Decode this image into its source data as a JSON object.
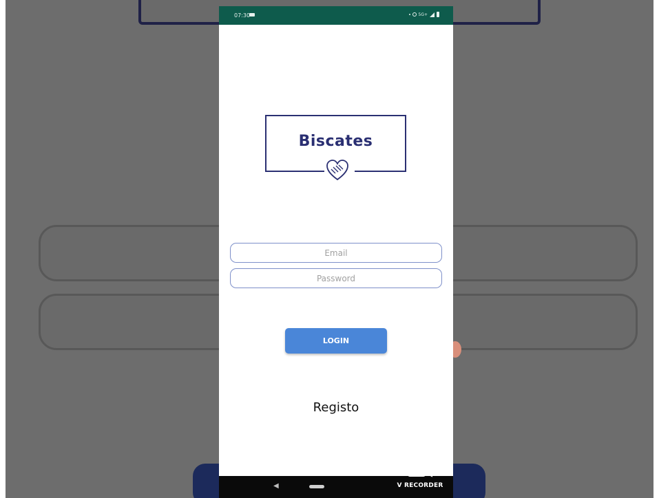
{
  "status_bar": {
    "time": "07:30",
    "network_label": "5G+",
    "bg_color": "#0e5b4c"
  },
  "logo": {
    "text": "Biscates",
    "icon": "handshake-heart-icon",
    "color": "#2a2f72"
  },
  "form": {
    "email_placeholder": "Email",
    "password_placeholder": "Password",
    "login_label": "LOGIN",
    "login_color": "#4a86d8",
    "register_label": "Registo"
  },
  "nav_bar": {
    "back_icon": "back-triangle-icon",
    "home_icon": "home-pill-icon"
  },
  "watermark": {
    "icon": "video-camera-icon",
    "label": "V RECORDER"
  }
}
